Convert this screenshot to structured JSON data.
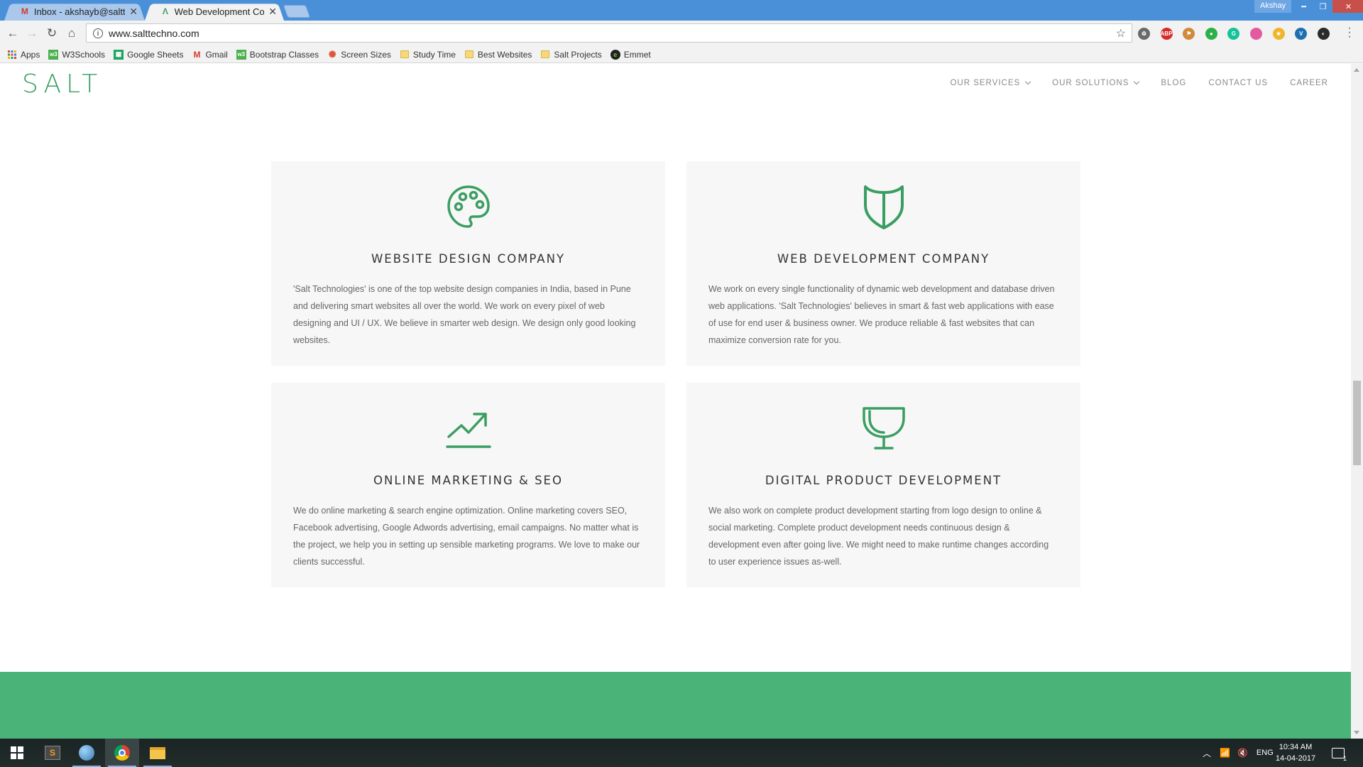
{
  "browser": {
    "tabs": [
      {
        "title": "Inbox - akshayb@saltte",
        "icon": "gmail-icon",
        "active": false
      },
      {
        "title": "Web Development Comp",
        "icon": "salt-icon",
        "active": true
      }
    ],
    "profile": "Akshay",
    "url": "www.salttechno.com",
    "bookmarks": [
      {
        "label": "Apps",
        "icon": "apps-grid-icon"
      },
      {
        "label": "W3Schools",
        "icon": "w3schools-icon"
      },
      {
        "label": "Google Sheets",
        "icon": "sheets-icon"
      },
      {
        "label": "Gmail",
        "icon": "gmail-icon"
      },
      {
        "label": "Bootstrap Classes",
        "icon": "bootstrap-icon"
      },
      {
        "label": "Screen Sizes",
        "icon": "screen-sizes-icon"
      },
      {
        "label": "Study Time",
        "icon": "folder-icon"
      },
      {
        "label": "Best Websites",
        "icon": "folder-icon"
      },
      {
        "label": "Salt Projects",
        "icon": "folder-icon"
      },
      {
        "label": "Emmet",
        "icon": "emmet-icon"
      }
    ],
    "extensions": [
      {
        "name": "recycle-extension-icon",
        "label": "♻",
        "color": "#6a6a6a"
      },
      {
        "name": "adblock-plus-icon",
        "label": "ABP",
        "color": "#d62b2b"
      },
      {
        "name": "paint-roller-extension-icon",
        "label": "⚑",
        "color": "#d08a3a"
      },
      {
        "name": "evernote-extension-icon",
        "label": "●",
        "color": "#2bb04a"
      },
      {
        "name": "grammarly-extension-icon",
        "label": "G",
        "color": "#15c39a"
      },
      {
        "name": "gradient-extension-icon",
        "label": "",
        "color": "#e45aa0"
      },
      {
        "name": "bookmark-star-extension-icon",
        "label": "★",
        "color": "#f0b62a"
      },
      {
        "name": "vimeo-extension-icon",
        "label": "V",
        "color": "#1e6fb0"
      },
      {
        "name": "dark-circle-extension-icon",
        "label": "◐",
        "color": "#2b2b2b"
      }
    ]
  },
  "site": {
    "logo": "SALT",
    "nav": [
      {
        "label": "OUR SERVICES",
        "dropdown": true
      },
      {
        "label": "OUR SOLUTIONS",
        "dropdown": true
      },
      {
        "label": "BLOG",
        "dropdown": false
      },
      {
        "label": "CONTACT US",
        "dropdown": false
      },
      {
        "label": "CAREER",
        "dropdown": false
      }
    ],
    "accent_color": "#3a9e62",
    "band_color": "#4ab378",
    "cards": [
      {
        "icon": "palette-icon",
        "title": "WEBSITE DESIGN COMPANY",
        "text": "'Salt Technologies' is one of the top website design companies in India, based in Pune and delivering smart websites all over the world. We work on every pixel of web designing and UI / UX. We believe in smarter web design. We design only good looking websites."
      },
      {
        "icon": "shield-icon",
        "title": "WEB DEVELOPMENT COMPANY",
        "text": "We work on every single functionality of dynamic web development and database driven web applications. 'Salt Technologies' believes in smart & fast web applications with ease of use for end user & business owner. We produce reliable & fast websites that can maximize conversion rate for you."
      },
      {
        "icon": "trending-up-icon",
        "title": "ONLINE MARKETING & SEO",
        "text": "We do online marketing & search engine optimization. Online marketing covers SEO, Facebook advertising, Google Adwords advertising, email campaigns. No matter what is the project, we help you in setting up sensible marketing programs. We love to make our clients successful."
      },
      {
        "icon": "trophy-icon",
        "title": "DIGITAL PRODUCT DEVELOPMENT",
        "text": "We also work on complete product development starting from logo design to online & social marketing. Complete product development needs continuous design & development even after going live. We might need to make runtime changes according to user experience issues as-well."
      }
    ]
  },
  "taskbar": {
    "language": "ENG",
    "time": "10:34 AM",
    "date": "14-04-2017",
    "notification_count": "1"
  }
}
